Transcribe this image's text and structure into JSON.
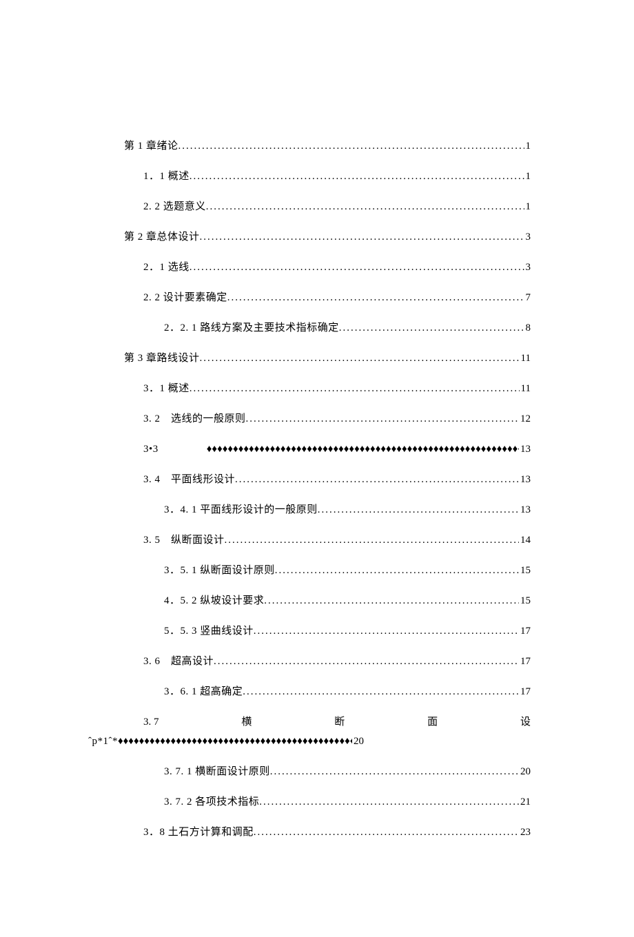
{
  "toc": [
    {
      "indent": 0,
      "label": "第 1 章绪论",
      "leader": "dots",
      "page": "1"
    },
    {
      "indent": 1,
      "label": "1．1 概述",
      "leader": "dots",
      "page": "1"
    },
    {
      "indent": 1,
      "label": "2. 2 选题意义",
      "leader": "dots",
      "page": "1"
    },
    {
      "indent": 0,
      "label": "第 2 章总体设计",
      "leader": "dots",
      "page": "3"
    },
    {
      "indent": 1,
      "label": "2．1 选线",
      "leader": "dots",
      "page": "3"
    },
    {
      "indent": 1,
      "label": "2. 2 设计要素确定",
      "leader": "dots",
      "page": "7"
    },
    {
      "indent": 2,
      "label": "2．2. 1 路线方案及主要技术指标确定",
      "leader": "dots",
      "page": "8"
    },
    {
      "indent": 0,
      "label": "第 3 章路线设计",
      "leader": "dots",
      "page": "11"
    },
    {
      "indent": 1,
      "label": "3．1 概述",
      "leader": "dots",
      "page": "11"
    },
    {
      "indent": 1,
      "label": "3. 2　选线的一般原则",
      "leader": "dots",
      "page": "12"
    },
    {
      "indent": 1,
      "label": "3•3",
      "leader": "diamonds",
      "page": "13",
      "gap": true
    },
    {
      "indent": 1,
      "label": "3. 4　平面线形设计",
      "leader": "dots",
      "page": "13"
    },
    {
      "indent": 2,
      "label": "3．4. 1 平面线形设计的一般原则",
      "leader": "dots",
      "page": "13"
    },
    {
      "indent": 1,
      "label": "3. 5　纵断面设计",
      "leader": "dots",
      "page": "14"
    },
    {
      "indent": 2,
      "label": "3．5. 1 纵断面设计原则",
      "leader": "dots",
      "page": "15"
    },
    {
      "indent": 2,
      "label": "4．5. 2 纵坡设计要求",
      "leader": "dots",
      "page": "15"
    },
    {
      "indent": 2,
      "label": "5．5. 3 竖曲线设计",
      "leader": "dots",
      "page": "17"
    },
    {
      "indent": 1,
      "label": "3. 6　超高设计",
      "leader": "dots",
      "page": "17"
    },
    {
      "indent": 2,
      "label": "3．6. 1 超高确定",
      "leader": "dots",
      "page": "17"
    }
  ],
  "row37": {
    "num": "3. 7",
    "chars": [
      "横",
      "断",
      "面",
      "设"
    ],
    "hangPrefix": "ˆp*1ˆ*",
    "page": "20"
  },
  "tocAfter": [
    {
      "indent": 2,
      "label": "3. 7. 1 横断面设计原则",
      "leader": "dots",
      "page": "20"
    },
    {
      "indent": 2,
      "label": "3. 7. 2 各项技术指标",
      "leader": "dots",
      "page": "21"
    },
    {
      "indent": 1,
      "label": "3．8 土石方计算和调配",
      "leader": "dots",
      "page": "23"
    }
  ]
}
